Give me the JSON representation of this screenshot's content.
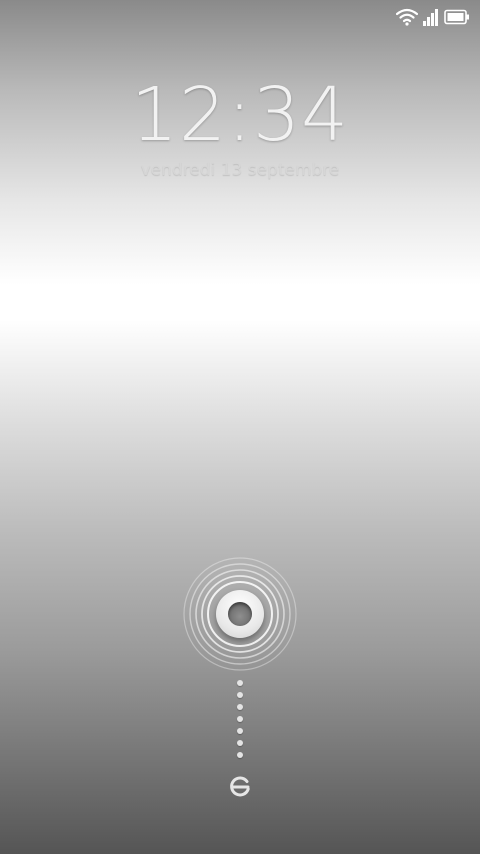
{
  "status_bar": {
    "icons": [
      "wifi-icon",
      "signal-icon",
      "battery-icon"
    ],
    "icon_color": "#ffffff"
  },
  "lockscreen": {
    "time": "12:34",
    "date": "vendredi 13 septembre"
  },
  "unlock": {
    "knob_icon": "unlock-knob-icon",
    "target_icon": "home-target-icon"
  },
  "colors": {
    "background_top": "#8a8a8a",
    "background_highlight": "#ffffff",
    "background_bottom": "#555555",
    "text_light": "#f2f2f2"
  }
}
